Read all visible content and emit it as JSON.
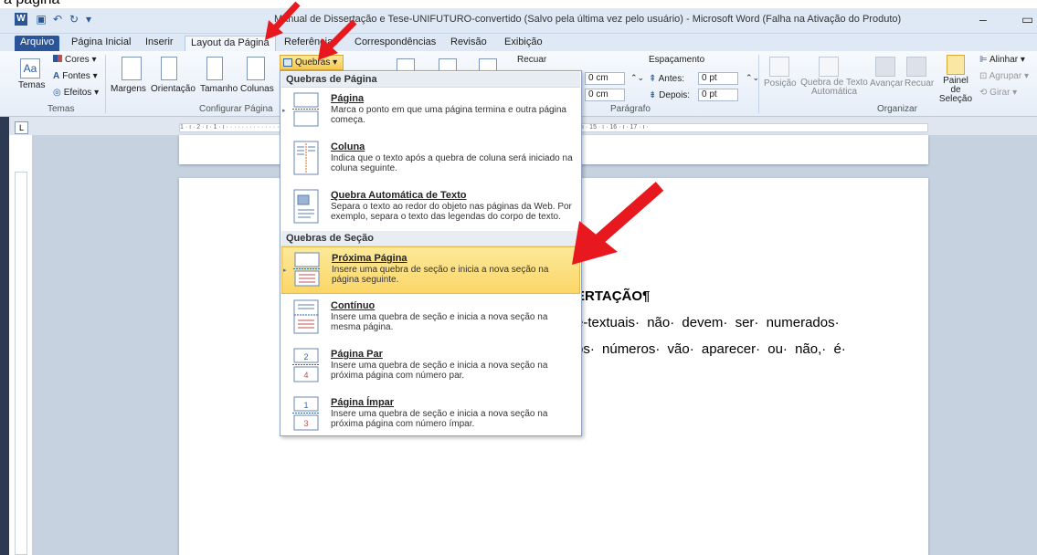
{
  "top_caption": "a página",
  "window": {
    "title": "Manual de Dissertação e Tese-UNIFUTURO-convertido (Salvo pela última vez pelo usuário) - Microsoft Word (Falha na Ativação do Produto)",
    "minimize": "–"
  },
  "tabs": [
    {
      "label": "Arquivo"
    },
    {
      "label": "Página Inicial"
    },
    {
      "label": "Inserir"
    },
    {
      "label": "Layout da Página"
    },
    {
      "label": "Referências"
    },
    {
      "label": "Correspondências"
    },
    {
      "label": "Revisão"
    },
    {
      "label": "Exibição"
    }
  ],
  "ribbon": {
    "temas": {
      "label": "Temas",
      "cores": "Cores",
      "fontes": "Fontes",
      "efeitos": "Efeitos",
      "group": "Temas"
    },
    "configurar": {
      "margens": "Margens",
      "orientacao": "Orientação",
      "tamanho": "Tamanho",
      "colunas": "Colunas",
      "group": "Configurar Página",
      "quebras": "Quebras"
    },
    "paragrafo": {
      "recuar": "Recuar",
      "espacamento": "Espaçamento",
      "esq": "0 cm",
      "dir": "0 cm",
      "antes_label": "Antes:",
      "antes_val": "0 pt",
      "depois_label": "Depois:",
      "depois_val": "0 pt",
      "group": "Parágrafo"
    },
    "organizar": {
      "posicao": "Posição",
      "quebra_texto": "Quebra de Texto Automática",
      "avancar": "Avançar",
      "recuar": "Recuar",
      "painel": "Painel de Seleção",
      "alinhar": "Alinhar",
      "agrupar": "Agrupar",
      "girar": "Girar",
      "group": "Organizar"
    }
  },
  "ruler": {
    "tab_selector": "L",
    "ticks": "1 · ı · 2 · ı · 1 · ı · · · · · · · · · · · · · · · · · · · · · · · · · · · · · · · · · · · · · · · · · · · · · · · · · · · · · · · · · · · · · ı · 9 · ı · 10 · ı · 11 · ı · 12 · ı · 13 · ı · 14 · ı · 15 · ı · 16 · ı · 17 · ı ·"
  },
  "document": {
    "heading": "ERTAÇÃO¶",
    "line1": "é-textuais· não· devem· ser· numerados·",
    "line2": "os· números· vão· aparecer· ou· não,· é·"
  },
  "dropdown": {
    "section1": "Quebras de Página",
    "section2": "Quebras de Seção",
    "items": [
      {
        "title": "Página",
        "desc": "Marca o ponto em que uma página termina e outra página começa."
      },
      {
        "title": "Coluna",
        "desc": "Indica que o texto após a quebra de coluna será iniciado na coluna seguinte."
      },
      {
        "title": "Quebra Automática de Texto",
        "desc": "Separa o texto ao redor do objeto nas páginas da Web. Por exemplo, separa o texto das legendas do corpo de texto."
      },
      {
        "title": "Próxima Página",
        "desc": "Insere uma quebra de seção e inicia a nova seção na página seguinte."
      },
      {
        "title": "Contínuo",
        "desc": "Insere uma quebra de seção e inicia a nova seção na mesma página."
      },
      {
        "title": "Página Par",
        "desc": "Insere uma quebra de seção e inicia a nova seção na próxima página com número par."
      },
      {
        "title": "Página Ímpar",
        "desc": "Insere uma quebra de seção e inicia a nova seção na próxima página com número ímpar."
      }
    ]
  },
  "colors": {
    "accent": "#2a5699",
    "highlight": "#fbd667",
    "annotation_arrow": "#e8191e"
  }
}
